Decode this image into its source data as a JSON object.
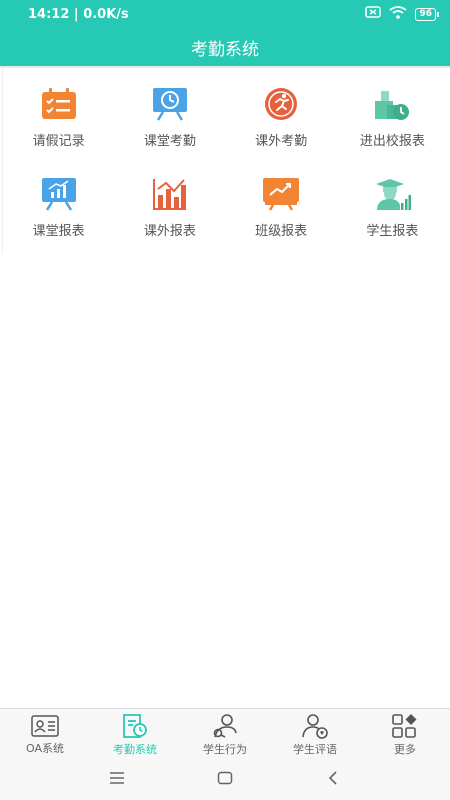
{
  "status": {
    "time": "14:12",
    "net_speed": "0.0K/s",
    "battery": "96"
  },
  "header": {
    "title": "考勤系统"
  },
  "grid": {
    "items": [
      {
        "label": "请假记录",
        "icon": "calendar-checklist-icon"
      },
      {
        "label": "课堂考勤",
        "icon": "classroom-clock-icon"
      },
      {
        "label": "课外考勤",
        "icon": "runner-icon"
      },
      {
        "label": "进出校报表",
        "icon": "school-building-clock-icon"
      },
      {
        "label": "课堂报表",
        "icon": "board-chart-icon"
      },
      {
        "label": "课外报表",
        "icon": "bar-chart-trend-icon"
      },
      {
        "label": "班级报表",
        "icon": "screen-trend-icon"
      },
      {
        "label": "学生报表",
        "icon": "graduate-chart-icon"
      }
    ]
  },
  "tabbar": {
    "items": [
      {
        "label": "OA系统",
        "icon": "id-card-icon"
      },
      {
        "label": "考勤系统",
        "icon": "attendance-doc-icon"
      },
      {
        "label": "学生行为",
        "icon": "behavior-icon"
      },
      {
        "label": "学生评语",
        "icon": "comment-user-icon"
      },
      {
        "label": "更多",
        "icon": "more-grid-icon"
      }
    ],
    "active_index": 1
  },
  "colors": {
    "primary": "#25c9b4",
    "orange": "#f28434",
    "blue": "#4aa3e6",
    "red": "#e8603c",
    "green": "#5cc6a6"
  }
}
